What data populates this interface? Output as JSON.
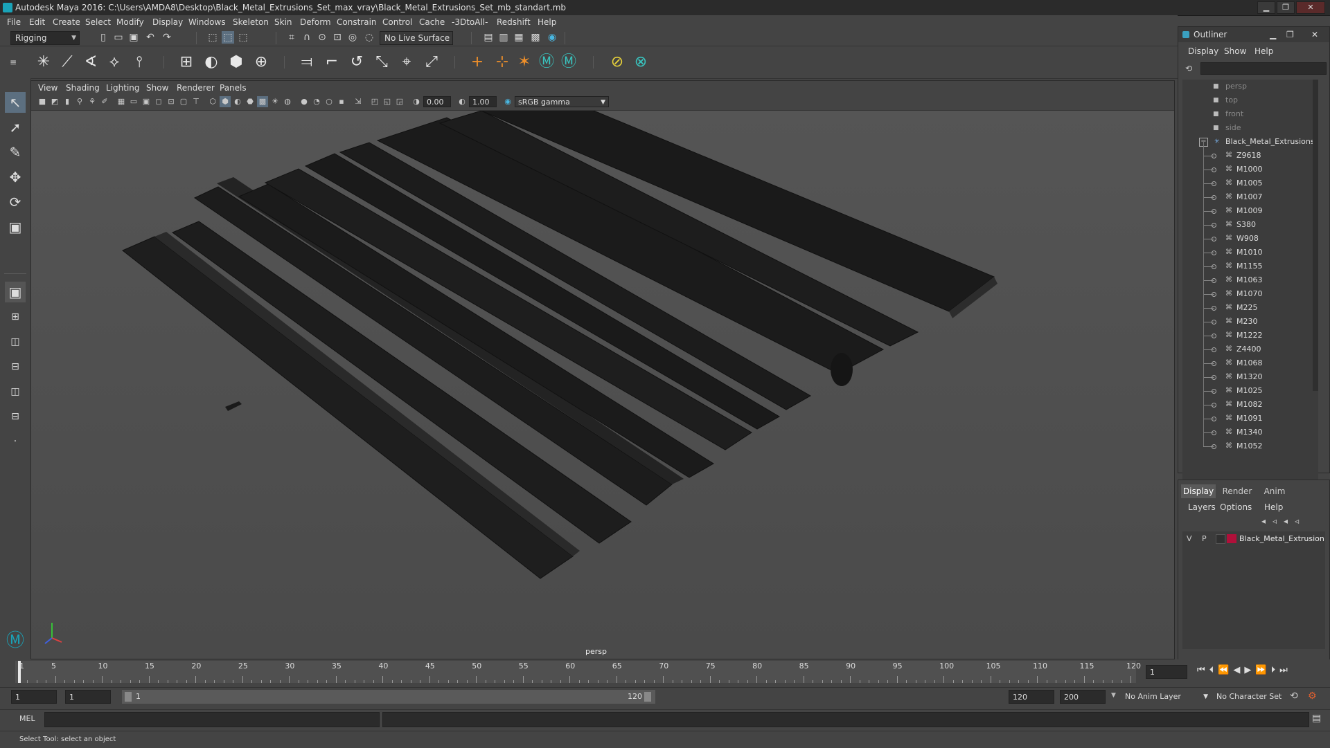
{
  "window": {
    "title": "Autodesk Maya 2016: C:\\Users\\AMDA8\\Desktop\\Black_Metal_Extrusions_Set_max_vray\\Black_Metal_Extrusions_Set_mb_standart.mb",
    "minimize": "▁",
    "restore": "❐",
    "close": "✕"
  },
  "menubar": [
    "File",
    "Edit",
    "Create",
    "Select",
    "Modify",
    "Display",
    "Windows",
    "Skeleton",
    "Skin",
    "Deform",
    "Constrain",
    "Control",
    "Cache",
    "-3DtoAll-",
    "Redshift",
    "Help"
  ],
  "statusline": {
    "menuset": "Rigging",
    "live_surface": "No Live Surface"
  },
  "viewport": {
    "menu": [
      "View",
      "Shading",
      "Lighting",
      "Show",
      "Renderer",
      "Panels"
    ],
    "exposure": "0.00",
    "gamma": "1.00",
    "colorspace": "sRGB gamma",
    "camera": "persp"
  },
  "outliner": {
    "title": "Outliner",
    "menu": [
      "Display",
      "Show",
      "Help"
    ],
    "cameras": [
      "persp",
      "top",
      "front",
      "side"
    ],
    "group": "Black_Metal_Extrusions_S",
    "items": [
      "Z9618",
      "M1000",
      "M1005",
      "M1007",
      "M1009",
      "S380",
      "W908",
      "M1010",
      "M1155",
      "M1063",
      "M1070",
      "M225",
      "M230",
      "M1222",
      "Z4400",
      "M1068",
      "M1320",
      "M1025",
      "M1082",
      "M1091",
      "M1340",
      "M1052"
    ]
  },
  "layers": {
    "tabs": [
      "Display",
      "Render",
      "Anim"
    ],
    "active_tab": "Display",
    "menu": [
      "Layers",
      "Options",
      "Help"
    ],
    "row": {
      "v": "V",
      "p": "P",
      "name": "Black_Metal_Extrusion",
      "color": "#b0103a"
    }
  },
  "timeline": {
    "ticks": [
      1,
      5,
      10,
      15,
      20,
      25,
      30,
      35,
      40,
      45,
      50,
      55,
      60,
      65,
      70,
      75,
      80,
      85,
      90,
      95,
      100,
      105,
      110,
      115,
      120
    ],
    "current_frame": "1",
    "range_start": "1",
    "range_current": "1",
    "slider_start": "1",
    "slider_end": "120",
    "end_frame": "120",
    "max_frame": "200",
    "anim_layer": "No Anim Layer",
    "character_set": "No Character Set"
  },
  "command": {
    "label": "MEL"
  },
  "help": {
    "text": "Select Tool: select an object"
  },
  "colors": {
    "accent": "#1aa3b8",
    "layer": "#b0103a",
    "timeline_marker": "#e8e8e8"
  }
}
